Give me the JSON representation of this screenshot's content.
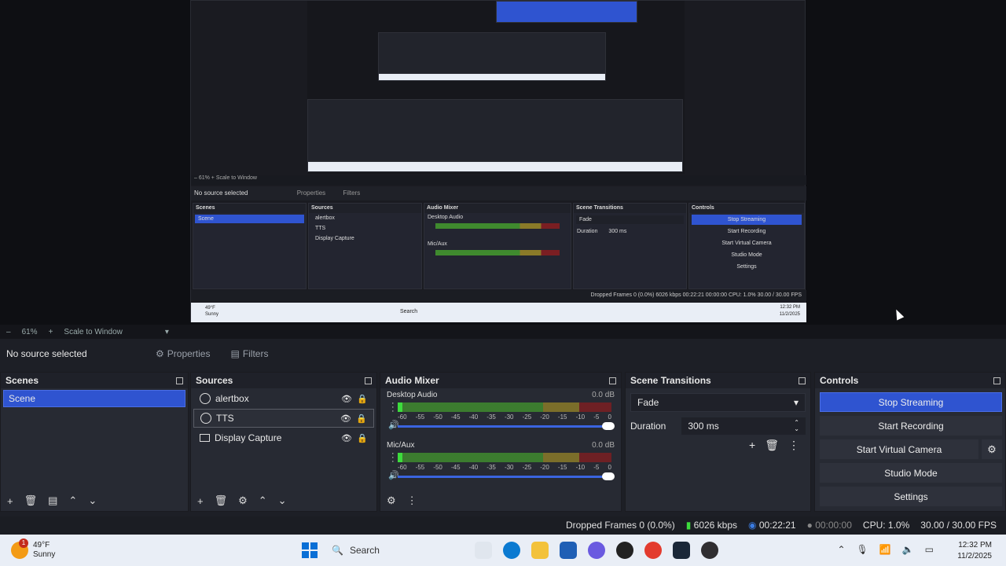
{
  "zoom_bar": {
    "minus": "–",
    "zoom": "61%",
    "plus": "+",
    "scale_mode": "Scale to Window",
    "chevron": "▾"
  },
  "toolbar": {
    "selection": "No source selected",
    "properties": "Properties",
    "filters": "Filters"
  },
  "scenes": {
    "title": "Scenes",
    "items": [
      "Scene"
    ]
  },
  "sources": {
    "title": "Sources",
    "items": [
      {
        "name": "alertbox",
        "icon": "globe-icon"
      },
      {
        "name": "TTS",
        "icon": "globe-icon"
      },
      {
        "name": "Display Capture",
        "icon": "monitor-icon"
      }
    ]
  },
  "mixer": {
    "title": "Audio Mixer",
    "channels": [
      {
        "name": "Desktop Audio",
        "db": "0.0 dB"
      },
      {
        "name": "Mic/Aux",
        "db": "0.0 dB"
      }
    ],
    "ticks": [
      "-60",
      "-55",
      "-50",
      "-45",
      "-40",
      "-35",
      "-30",
      "-25",
      "-20",
      "-15",
      "-10",
      "-5",
      "0"
    ]
  },
  "transitions": {
    "title": "Scene Transitions",
    "selected": "Fade",
    "duration_label": "Duration",
    "duration_value": "300 ms"
  },
  "controls": {
    "title": "Controls",
    "stop_streaming": "Stop Streaming",
    "start_recording": "Start Recording",
    "start_virtual_camera": "Start Virtual Camera",
    "studio_mode": "Studio Mode",
    "settings": "Settings"
  },
  "status": {
    "dropped_frames": "Dropped Frames 0 (0.0%)",
    "bitrate": "6026 kbps",
    "stream_time": "00:22:21",
    "record_time": "00:00:00",
    "cpu": "CPU: 1.0%",
    "fps": "30.00 / 30.00 FPS"
  },
  "taskbar": {
    "weather_temp": "49°F",
    "weather_cond": "Sunny",
    "weather_badge": "1",
    "search": "Search",
    "time": "12:32 PM",
    "date": "11/2/2025"
  },
  "nested": {
    "zoom_text": "– 61% + Scale to Window",
    "selection": "No source selected",
    "properties": "Properties",
    "filters": "Filters",
    "scenes": "Scenes",
    "scene_item": "Scene",
    "sources": "Sources",
    "src1": "alertbox",
    "src2": "TTS",
    "src3": "Display Capture",
    "mixer": "Audio Mixer",
    "ch1": "Desktop Audio",
    "ch2": "Mic/Aux",
    "transitions": "Scene Transitions",
    "fade": "Fade",
    "duration": "Duration",
    "dur_val": "300 ms",
    "controls": "Controls",
    "stop": "Stop Streaming",
    "rec": "Start Recording",
    "vcam": "Start Virtual Camera",
    "studio": "Studio Mode",
    "settings": "Settings",
    "status": "Dropped Frames 0 (0.0%)  6026 kbps  00:22:21  00:00:00  CPU: 1.0%  30.00 / 30.00 FPS",
    "temp": "49°F",
    "cond": "Sunny",
    "search": "Search",
    "time": "12:32 PM",
    "date": "11/2/2025"
  }
}
